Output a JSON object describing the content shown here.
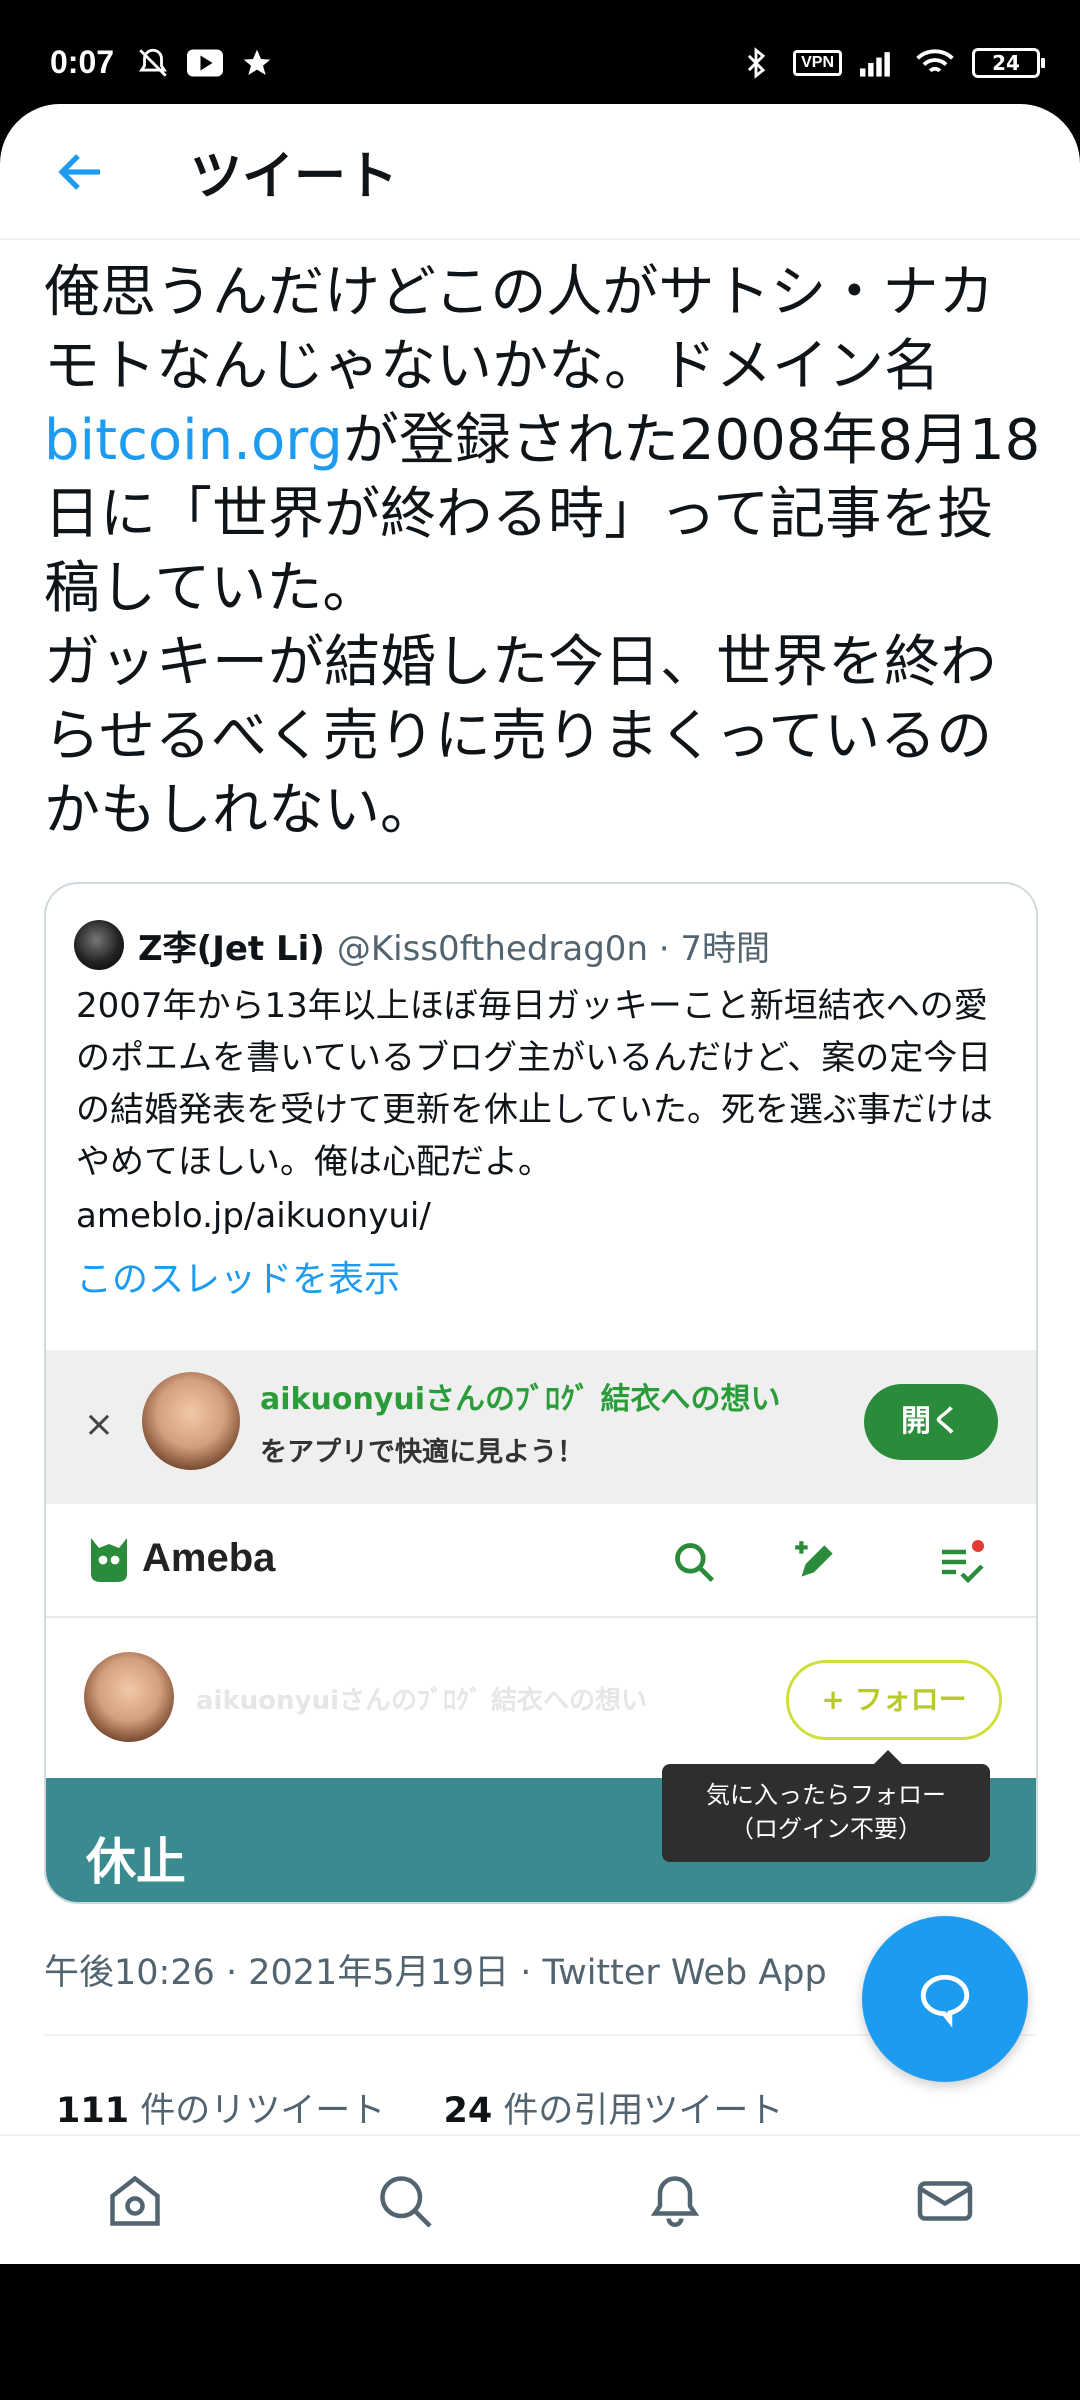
{
  "status_bar": {
    "time": "0:07",
    "vpn": "VPN",
    "battery": "24",
    "left_icons": [
      "bell-muted-icon",
      "youtube-icon",
      "star-icon"
    ],
    "right_icons": [
      "bluetooth-icon",
      "vpn-badge",
      "signal-icon",
      "wifi-icon",
      "battery-icon"
    ]
  },
  "header": {
    "title": "ツイート",
    "back_icon": "arrow-left-icon"
  },
  "tweet": {
    "text_before_link": "俺思うんだけどこの人がサトシ・ナカモトなんじゃないかな。ドメイン名",
    "link": "bitcoin.org",
    "text_after_link": "が登録された2008年8月18日に「世界が終わる時」って記事を投稿していた。\nガッキーが結婚した今日、世界を終わらせるべく売りに売りまくっているのかもしれない。",
    "meta": "午後10:26 · 2021年5月19日 · Twitter Web App",
    "retweets_count": "111",
    "retweets_label": " 件のリツイート",
    "quotes_count": "24",
    "quotes_label": " 件の引用ツイート"
  },
  "quote": {
    "name": "Z李(Jet Li)",
    "handle": "@Kiss0fthedrag0n · 7時間",
    "text": "2007年から13年以上ほぼ毎日ガッキーこと新垣結衣への愛のポエムを書いているブログ主がいるんだけど、案の定今日の結婚発表を受けて更新を休止していた。死を選ぶ事だけはやめてほしい。俺は心配だよ。",
    "link": "ameblo.jp/aikuonyui/",
    "show_thread": "このスレッドを表示"
  },
  "ameba": {
    "banner_close": "×",
    "banner_title": "aikuonyuiさんのﾌﾞﾛｸﾞ 結衣への想い",
    "banner_sub": "をアプリで快適に見よう！",
    "open_button": "開く",
    "logo_text": "Ameba",
    "follow_name": "aikuonyuiさんのﾌﾞﾛｸﾞ 結衣への想い",
    "follow_button": "+ フォロー",
    "tooltip_line1": "気に入ったらフォロー",
    "tooltip_line2": "（ログイン不要）",
    "section_title": "休止",
    "colors": {
      "green": "#2a8c3a",
      "teal": "#3a8b90"
    }
  },
  "tab_bar": {
    "items": [
      "home-icon",
      "search-icon",
      "notifications-icon",
      "messages-icon"
    ]
  },
  "colors": {
    "accent": "#1d9bf0",
    "text": "#0f1419",
    "secondary": "#536471"
  }
}
